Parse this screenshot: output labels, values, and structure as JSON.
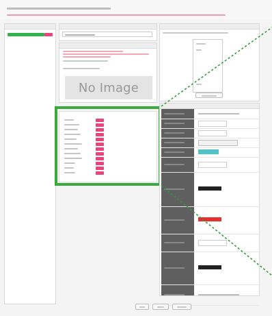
{
  "image_panel": {
    "placeholder_text": "No Image"
  }
}
